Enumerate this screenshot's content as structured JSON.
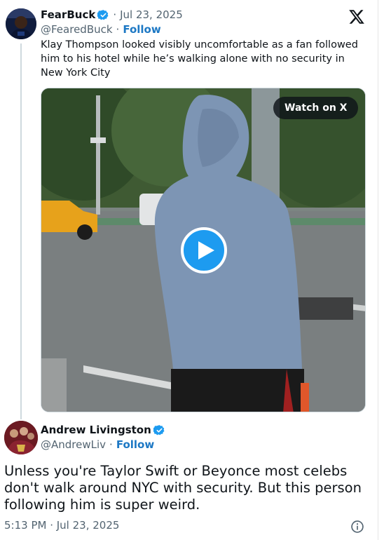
{
  "quoted_tweet": {
    "author_name": "FearBuck",
    "date": "Jul 23, 2025",
    "handle": "@FearedBuck",
    "follow_label": "Follow",
    "text": "Klay Thompson looked visibly uncomfortable as a fan followed him to his hotel while he’s walking alone with no security in New York City",
    "verified": true
  },
  "video": {
    "watch_label": "Watch on X",
    "play_icon": "play-icon"
  },
  "main_tweet": {
    "author_name": "Andrew Livingston",
    "handle": "@AndrewLiv",
    "follow_label": "Follow",
    "text": "Unless you're Taylor Swift or Beyonce most celebs don't walk around NYC with security. But this person following him is super weird.",
    "timestamp": "5:13 PM · Jul 23, 2025",
    "verified": true
  },
  "icons": {
    "logo": "x-logo-icon",
    "verified": "verified-badge-icon",
    "info": "info-icon"
  },
  "colors": {
    "accent": "#1d9bf0",
    "link": "#1d78c4",
    "muted": "#536471",
    "text": "#0f1419"
  }
}
